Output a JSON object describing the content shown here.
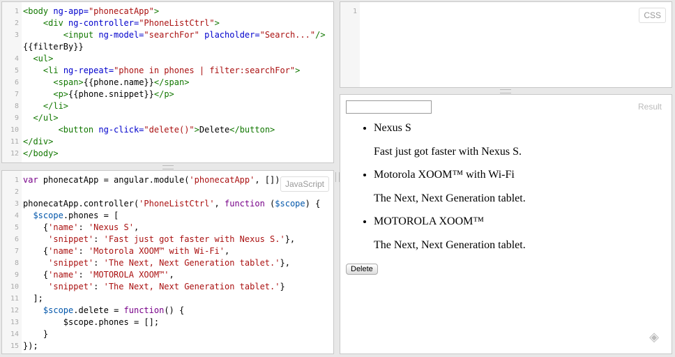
{
  "html_panel": {
    "lines": [
      {
        "n": "1",
        "parts": [
          [
            "tag",
            "<body "
          ],
          [
            "attr",
            "ng-app="
          ],
          [
            "str",
            "\"phonecatApp\""
          ],
          [
            "tag",
            ">"
          ]
        ]
      },
      {
        "n": "2",
        "parts": [
          [
            "plain",
            "    "
          ],
          [
            "tag",
            "<div "
          ],
          [
            "attr",
            "ng-controller="
          ],
          [
            "str",
            "\"PhoneListCtrl\""
          ],
          [
            "tag",
            ">"
          ]
        ]
      },
      {
        "n": "3",
        "parts": [
          [
            "plain",
            "        "
          ],
          [
            "tag",
            "<input "
          ],
          [
            "attr",
            "ng-model="
          ],
          [
            "str",
            "\"searchFor\""
          ],
          [
            "plain",
            " "
          ],
          [
            "attr",
            "placholder="
          ],
          [
            "str",
            "\"Search...\""
          ],
          [
            "tag",
            "/>"
          ]
        ]
      },
      {
        "n": "",
        "parts": [
          [
            "plain",
            "{{filterBy}}"
          ]
        ]
      },
      {
        "n": "4",
        "parts": [
          [
            "plain",
            "  "
          ],
          [
            "tag",
            "<ul>"
          ]
        ]
      },
      {
        "n": "5",
        "parts": [
          [
            "plain",
            "    "
          ],
          [
            "tag",
            "<li "
          ],
          [
            "attr",
            "ng-repeat="
          ],
          [
            "str",
            "\"phone in phones | filter:searchFor\""
          ],
          [
            "tag",
            ">"
          ]
        ]
      },
      {
        "n": "6",
        "parts": [
          [
            "plain",
            "      "
          ],
          [
            "tag",
            "<span>"
          ],
          [
            "plain",
            "{{phone.name}}"
          ],
          [
            "tag",
            "</span>"
          ]
        ]
      },
      {
        "n": "7",
        "parts": [
          [
            "plain",
            "      "
          ],
          [
            "tag",
            "<p>"
          ],
          [
            "plain",
            "{{phone.snippet}}"
          ],
          [
            "tag",
            "</p>"
          ]
        ]
      },
      {
        "n": "8",
        "parts": [
          [
            "plain",
            "    "
          ],
          [
            "tag",
            "</li>"
          ]
        ]
      },
      {
        "n": "9",
        "parts": [
          [
            "plain",
            "  "
          ],
          [
            "tag",
            "</ul>"
          ]
        ]
      },
      {
        "n": "10",
        "parts": [
          [
            "plain",
            "       "
          ],
          [
            "tag",
            "<button "
          ],
          [
            "attr",
            "ng-click="
          ],
          [
            "str",
            "\"delete()\""
          ],
          [
            "tag",
            ">"
          ],
          [
            "plain",
            "Delete"
          ],
          [
            "tag",
            "</button>"
          ]
        ]
      },
      {
        "n": "11",
        "parts": [
          [
            "tag",
            "</div>"
          ]
        ]
      },
      {
        "n": "12",
        "parts": [
          [
            "tag",
            "</body>"
          ]
        ]
      }
    ]
  },
  "js_panel": {
    "label": "JavaScript",
    "lines": [
      {
        "n": "1",
        "parts": [
          [
            "kw",
            "var "
          ],
          [
            "plain",
            "phonecatApp = angular.module("
          ],
          [
            "str",
            "'phonecatApp'"
          ],
          [
            "plain",
            ", []);"
          ]
        ]
      },
      {
        "n": "2",
        "parts": []
      },
      {
        "n": "3",
        "parts": [
          [
            "plain",
            "phonecatApp.controller("
          ],
          [
            "str",
            "'PhoneListCtrl'"
          ],
          [
            "plain",
            ", "
          ],
          [
            "kw",
            "function "
          ],
          [
            "plain",
            "("
          ],
          [
            "var",
            "$scope"
          ],
          [
            "plain",
            ") {"
          ]
        ]
      },
      {
        "n": "4",
        "parts": [
          [
            "plain",
            "  "
          ],
          [
            "var",
            "$scope"
          ],
          [
            "plain",
            ".phones = ["
          ]
        ]
      },
      {
        "n": "5",
        "parts": [
          [
            "plain",
            "    {"
          ],
          [
            "str",
            "'name'"
          ],
          [
            "plain",
            ": "
          ],
          [
            "str",
            "'Nexus S'"
          ],
          [
            "plain",
            ","
          ]
        ]
      },
      {
        "n": "6",
        "parts": [
          [
            "plain",
            "     "
          ],
          [
            "str",
            "'snippet'"
          ],
          [
            "plain",
            ": "
          ],
          [
            "str",
            "'Fast just got faster with Nexus S.'"
          ],
          [
            "plain",
            "},"
          ]
        ]
      },
      {
        "n": "7",
        "parts": [
          [
            "plain",
            "    {"
          ],
          [
            "str",
            "'name'"
          ],
          [
            "plain",
            ": "
          ],
          [
            "str",
            "'Motorola XOOM™ with Wi-Fi'"
          ],
          [
            "plain",
            ","
          ]
        ]
      },
      {
        "n": "8",
        "parts": [
          [
            "plain",
            "     "
          ],
          [
            "str",
            "'snippet'"
          ],
          [
            "plain",
            ": "
          ],
          [
            "str",
            "'The Next, Next Generation tablet.'"
          ],
          [
            "plain",
            "},"
          ]
        ]
      },
      {
        "n": "9",
        "parts": [
          [
            "plain",
            "    {"
          ],
          [
            "str",
            "'name'"
          ],
          [
            "plain",
            ": "
          ],
          [
            "str",
            "'MOTOROLA XOOM™'"
          ],
          [
            "plain",
            ","
          ]
        ]
      },
      {
        "n": "10",
        "parts": [
          [
            "plain",
            "     "
          ],
          [
            "str",
            "'snippet'"
          ],
          [
            "plain",
            ": "
          ],
          [
            "str",
            "'The Next, Next Generation tablet.'"
          ],
          [
            "plain",
            "}"
          ]
        ]
      },
      {
        "n": "11",
        "parts": [
          [
            "plain",
            "  ];"
          ]
        ]
      },
      {
        "n": "12",
        "parts": [
          [
            "plain",
            "    "
          ],
          [
            "var",
            "$scope"
          ],
          [
            "plain",
            ".delete = "
          ],
          [
            "kw",
            "function"
          ],
          [
            "plain",
            "() {"
          ]
        ]
      },
      {
        "n": "13",
        "parts": [
          [
            "plain",
            "        $scope.phones = [];"
          ]
        ]
      },
      {
        "n": "14",
        "parts": [
          [
            "plain",
            "    }"
          ]
        ]
      },
      {
        "n": "15",
        "parts": [
          [
            "plain",
            "});"
          ]
        ]
      }
    ]
  },
  "css_panel": {
    "label": "CSS",
    "lines": [
      {
        "n": "1",
        "parts": []
      }
    ]
  },
  "result_panel": {
    "label": "Result",
    "search_value": "",
    "phones": [
      {
        "name": "Nexus S",
        "snippet": "Fast just got faster with Nexus S."
      },
      {
        "name": "Motorola XOOM™  with Wi-Fi",
        "snippet": "The Next, Next Generation tablet."
      },
      {
        "name": "MOTOROLA XOOM™",
        "snippet": "The Next, Next Generation tablet."
      }
    ],
    "delete_label": "Delete",
    "corner_icon": "jsfiddle-logo-icon"
  }
}
